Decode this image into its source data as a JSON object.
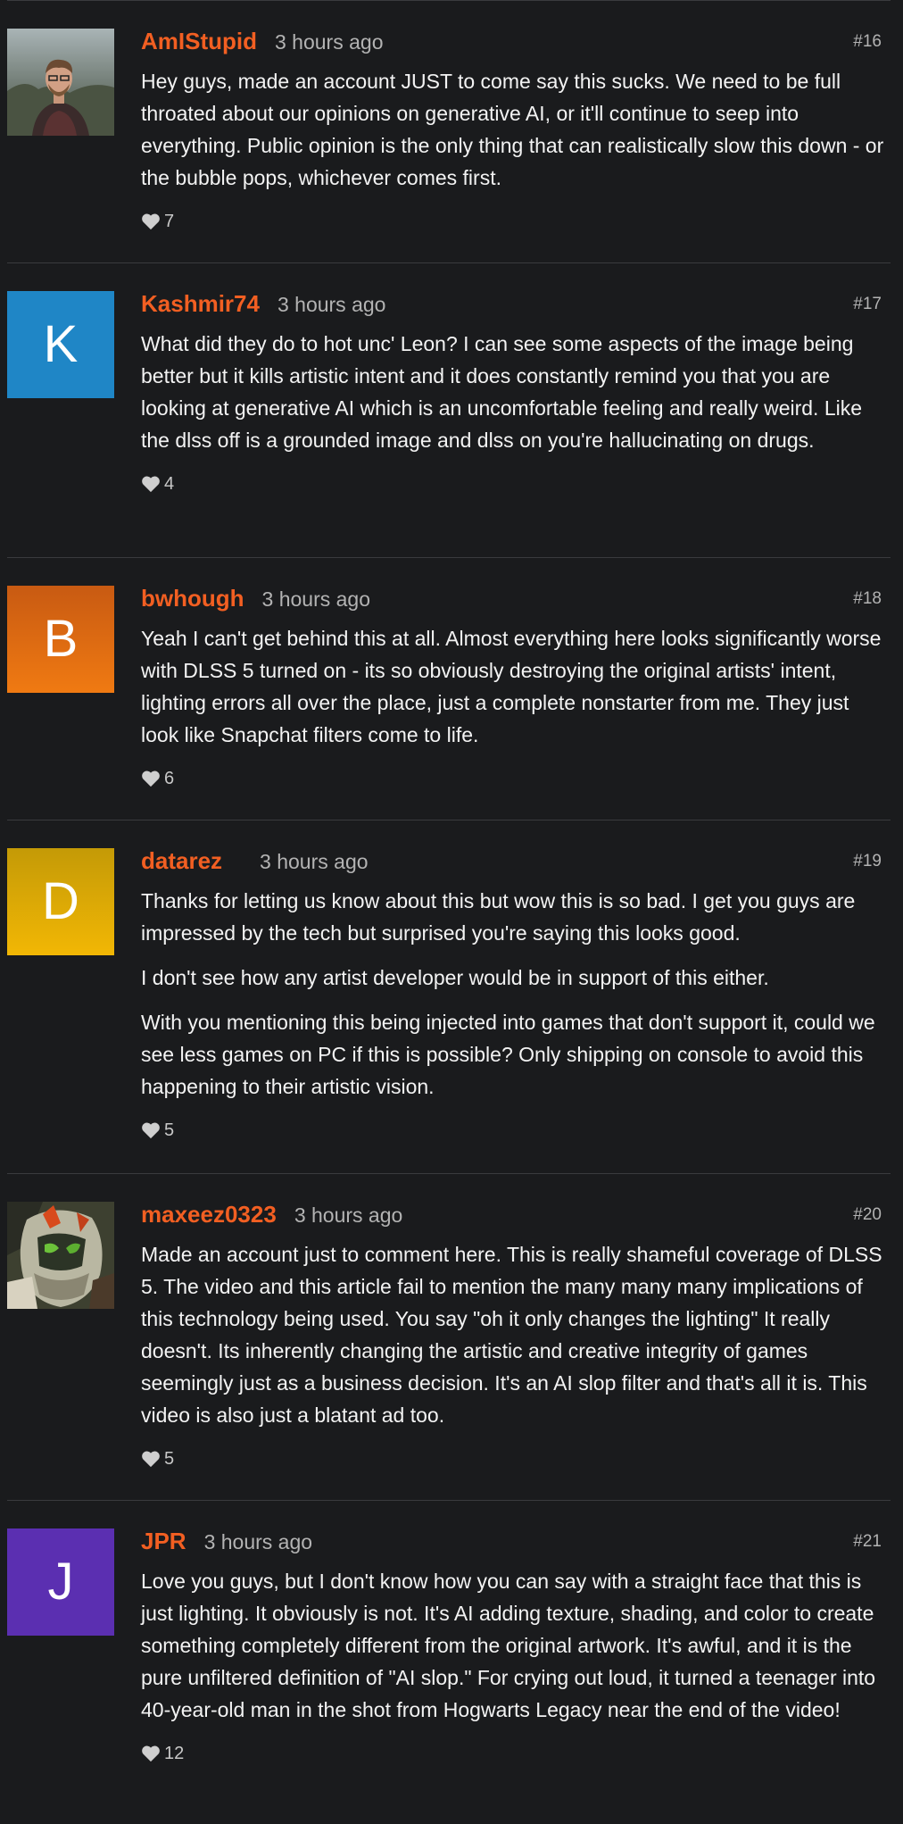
{
  "comments": [
    {
      "username": "AmIStupid",
      "time": "3 hours ago",
      "number": "#16",
      "avatar_initial": "",
      "avatar_type": "photo-person",
      "likes": "7",
      "paragraphs": [
        "Hey guys, made an account JUST to come say this sucks. We need to be full throated about our opinions on generative AI, or it'll continue to seep into everything. Public opinion is the only thing that can realistically slow this down - or the bubble pops, whichever comes first."
      ]
    },
    {
      "username": "Kashmir74",
      "time": "3 hours ago",
      "number": "#17",
      "avatar_initial": "K",
      "avatar_type": "initial",
      "likes": "4",
      "paragraphs": [
        "What did they do to hot unc' Leon? I can see some aspects of the image being better but it kills artistic intent and it does constantly remind you that you are looking at generative AI which is an uncomfortable feeling and really weird. Like the dlss off is a grounded image and dlss on you're hallucinating on drugs."
      ]
    },
    {
      "username": "bwhough",
      "time": "3 hours ago",
      "number": "#18",
      "avatar_initial": "B",
      "avatar_type": "initial",
      "likes": "6",
      "paragraphs": [
        "Yeah I can't get behind this at all. Almost everything here looks significantly worse with DLSS 5 turned on - its so obviously destroying the original artists' intent, lighting errors all over the place, just a complete nonstarter from me. They just look like Snapchat filters come to life."
      ]
    },
    {
      "username": "datarez",
      "time": "3 hours ago",
      "number": "#19",
      "avatar_initial": "D",
      "avatar_type": "initial",
      "likes": "5",
      "paragraphs": [
        "Thanks for letting us know about this but wow this is so bad. I get you guys are impressed by the tech but surprised you're saying this looks good.",
        "I don't see how any artist developer would be in support of this either.",
        "With you mentioning this being injected into games that don't support it, could we see less games on PC if this is possible? Only shipping on console to avoid this happening to their artistic vision."
      ]
    },
    {
      "username": "maxeez0323",
      "time": "3 hours ago",
      "number": "#20",
      "avatar_initial": "",
      "avatar_type": "photo-robot",
      "likes": "5",
      "paragraphs": [
        "Made an account just to comment here. This is really shameful coverage of DLSS 5. The video and this article fail to mention the many many many implications of this technology being used. You say \"oh it only changes the lighting\" It really doesn't. Its inherently changing the artistic and creative integrity of games seemingly just as a business decision. It's an AI slop filter and that's all it is. This video is also just a blatant ad too."
      ]
    },
    {
      "username": "JPR",
      "time": "3 hours ago",
      "number": "#21",
      "avatar_initial": "J",
      "avatar_type": "initial",
      "likes": "12",
      "paragraphs": [
        "Love you guys, but I don't know how you can say with a straight face that this is just lighting. It obviously is not. It's AI adding texture, shading, and color to create something completely different from the original artwork. It's awful, and it is the pure unfiltered definition of \"AI slop.\" For crying out loud, it turned a teenager into 40-year-old man in the shot from Hogwarts Legacy near the end of the video!"
      ]
    }
  ],
  "colors": {
    "background": "#1a1b1d",
    "username": "#f25f22",
    "meta": "#b3b3b3",
    "avatar_kashmir": "#1f86c6",
    "avatar_bwhough": "#f07a12",
    "avatar_datarez": "#e8ad04",
    "avatar_jpr": "#5b2fb1"
  }
}
